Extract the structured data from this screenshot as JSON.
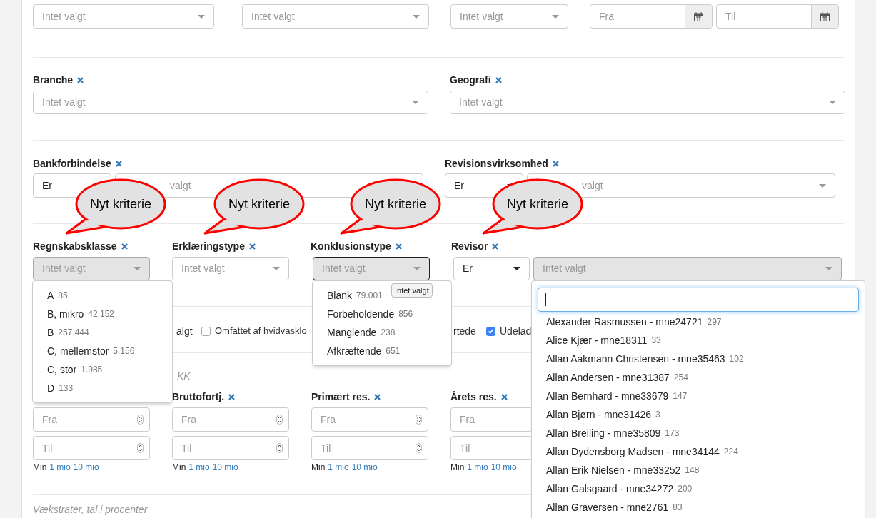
{
  "top_filters": [
    {
      "kind": "select",
      "placeholder": "Intet valgt"
    },
    {
      "kind": "select",
      "placeholder": "Intet valgt"
    },
    {
      "kind": "select",
      "placeholder": "Intet valgt"
    },
    {
      "kind": "date",
      "placeholder": "Fra"
    },
    {
      "kind": "date",
      "placeholder": "Til"
    }
  ],
  "location_filters": [
    {
      "label": "Branche",
      "placeholder": "Intet valgt"
    },
    {
      "label": "Geografi",
      "placeholder": "Intet valgt"
    }
  ],
  "relation_filters": [
    {
      "label": "Bankforbindelse",
      "operator": "Er",
      "value_visible": "valgt"
    },
    {
      "label": "Revisionsvirksomhed",
      "operator": "Er",
      "value_visible": "valgt"
    }
  ],
  "callouts": [
    "Nyt kriterie",
    "Nyt kriterie",
    "Nyt kriterie",
    "Nyt kriterie"
  ],
  "criteria": [
    {
      "label": "Regnskabsklasse",
      "kind": "select",
      "placeholder": "Intet valgt",
      "open": true,
      "focused": false,
      "options": [
        {
          "label": "A",
          "count": "85"
        },
        {
          "label": "B, mikro",
          "count": "42.152"
        },
        {
          "label": "B",
          "count": "257.444"
        },
        {
          "label": "C, mellemstor",
          "count": "5.156"
        },
        {
          "label": "C, stor",
          "count": "1.985"
        },
        {
          "label": "D",
          "count": "133"
        }
      ]
    },
    {
      "label": "Erklæringstype",
      "kind": "select",
      "placeholder": "Intet valgt",
      "open": false,
      "focused": false
    },
    {
      "label": "Konklusionstype",
      "kind": "select",
      "placeholder": "Intet valgt",
      "open": true,
      "focused": true,
      "tooltip": "Intet valgt",
      "options": [
        {
          "label": "Blank",
          "count": "79.001"
        },
        {
          "label": "Forbeholdende",
          "count": "856"
        },
        {
          "label": "Manglende",
          "count": "238"
        },
        {
          "label": "Afkræftende",
          "count": "651"
        }
      ]
    },
    {
      "label": "Revisor",
      "kind": "operator_select",
      "operator": "Er",
      "placeholder": "Intet valgt",
      "open": true,
      "focused": false,
      "options": [
        {
          "label": "Alexander Rasmussen - mne24721",
          "count": "297"
        },
        {
          "label": "Alice Kjær - mne18311",
          "count": "33"
        },
        {
          "label": "Allan Aakmann Christensen - mne35463",
          "count": "102"
        },
        {
          "label": "Allan Andersen - mne31387",
          "count": "254"
        },
        {
          "label": "Allan Bernhard - mne33679",
          "count": "147"
        },
        {
          "label": "Allan Bjørn - mne31426",
          "count": "3"
        },
        {
          "label": "Allan Breiling - mne35809",
          "count": "173"
        },
        {
          "label": "Allan Dydensborg Madsen - mne34144",
          "count": "224"
        },
        {
          "label": "Allan Erik Nielsen - mne33252",
          "count": "148"
        },
        {
          "label": "Allan Galsgaard - mne34272",
          "count": "200"
        },
        {
          "label": "Allan Graversen - mne2761",
          "count": "83"
        }
      ]
    }
  ],
  "checkboxes": [
    {
      "kind": "fragment",
      "label": "algt"
    },
    {
      "kind": "checkbox",
      "label": "Omfattet af hvidvasklo",
      "checked": false
    },
    {
      "kind": "fragment",
      "label": "rtede"
    },
    {
      "kind": "checkbox",
      "label": "Udelad",
      "checked": true
    }
  ],
  "financials": {
    "heading": "KK",
    "columns": [
      {
        "from_placeholder": "Fra",
        "to_placeholder": "Til",
        "hint": "Min",
        "links": [
          "1 mio",
          "10 mio"
        ]
      },
      {
        "label": "Bruttofortj.",
        "from_placeholder": "Fra",
        "to_placeholder": "Til",
        "hint": "Min",
        "links": [
          "1 mio",
          "10 mio"
        ]
      },
      {
        "label": "Primært res.",
        "from_placeholder": "Fra",
        "to_placeholder": "Til",
        "hint": "Min",
        "links": [
          "1 mio",
          "10 mio"
        ]
      },
      {
        "label": "Årets res.",
        "from_placeholder": "Fra",
        "to_placeholder": "Til",
        "hint": "Min",
        "links": [
          "1 mio",
          "10 mio"
        ]
      }
    ]
  },
  "growth_heading": "Vækstrater, tal i procenter"
}
